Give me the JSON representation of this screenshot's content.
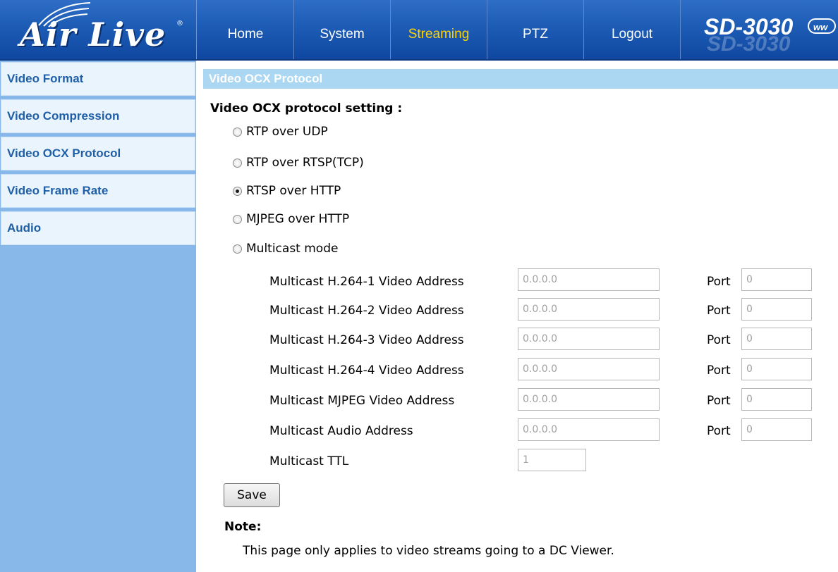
{
  "header": {
    "logo_text": "Air Live",
    "logo_reg": "®",
    "model": "SD-3030",
    "model_ghost": "SD-3030",
    "www_badge": "ww"
  },
  "nav": {
    "items": [
      {
        "label": "Home",
        "active": false
      },
      {
        "label": "System",
        "active": false
      },
      {
        "label": "Streaming",
        "active": true
      },
      {
        "label": "PTZ",
        "active": false
      },
      {
        "label": "Logout",
        "active": false
      }
    ]
  },
  "sidebar": {
    "items": [
      {
        "label": "Video Format"
      },
      {
        "label": "Video Compression"
      },
      {
        "label": "Video OCX Protocol"
      },
      {
        "label": "Video Frame Rate"
      },
      {
        "label": "Audio"
      }
    ]
  },
  "main": {
    "section_title": "Video OCX Protocol",
    "setting_heading": "Video OCX protocol setting :",
    "protocols": [
      {
        "label": "RTP over UDP",
        "checked": false
      },
      {
        "label": "RTP over RTSP(TCP)",
        "checked": false
      },
      {
        "label": "RTSP over HTTP",
        "checked": true
      },
      {
        "label": "MJPEG over HTTP",
        "checked": false
      },
      {
        "label": "Multicast mode",
        "checked": false
      }
    ],
    "multicast": {
      "port_label": "Port",
      "rows": [
        {
          "label": "Multicast H.264-1 Video Address",
          "address": "0.0.0.0",
          "port": "0"
        },
        {
          "label": "Multicast H.264-2 Video Address",
          "address": "0.0.0.0",
          "port": "0"
        },
        {
          "label": "Multicast H.264-3 Video Address",
          "address": "0.0.0.0",
          "port": "0"
        },
        {
          "label": "Multicast H.264-4 Video Address",
          "address": "0.0.0.0",
          "port": "0"
        },
        {
          "label": "Multicast MJPEG Video Address",
          "address": "0.0.0.0",
          "port": "0"
        },
        {
          "label": "Multicast Audio Address",
          "address": "0.0.0.0",
          "port": "0"
        }
      ],
      "ttl_label": "Multicast TTL",
      "ttl_value": "1"
    },
    "save_label": "Save",
    "note_heading": "Note:",
    "note_text": "This page only applies to video streams going to a DC Viewer."
  }
}
